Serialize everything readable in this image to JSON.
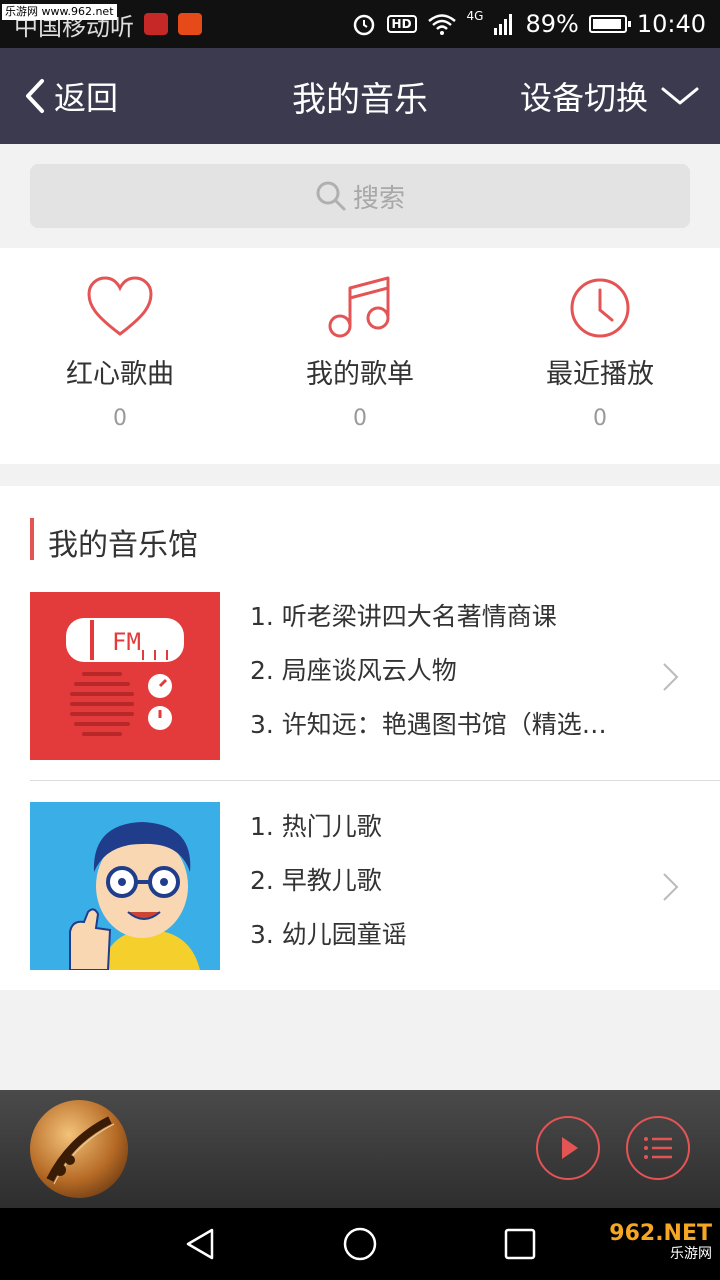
{
  "statusbar": {
    "watermark": "乐游网 www.962.net",
    "carrier": "中国移动听",
    "hd": "HD",
    "network": "4G",
    "battery": "89%",
    "time": "10:40"
  },
  "navbar": {
    "back_label": "返回",
    "title": "我的音乐",
    "device_switch_label": "设备切换"
  },
  "search": {
    "placeholder": "搜索"
  },
  "quick_entries": [
    {
      "label": "红心歌曲",
      "count": "0",
      "icon": "heart-icon"
    },
    {
      "label": "我的歌单",
      "count": "0",
      "icon": "music-note-icon"
    },
    {
      "label": "最近播放",
      "count": "0",
      "icon": "clock-icon"
    }
  ],
  "music_hall": {
    "title": "我的音乐馆",
    "cards": [
      {
        "thumb": "fm-radio",
        "items": [
          "1. 听老梁讲四大名著情商课",
          "2. 局座谈风云人物",
          "3. 许知远：艳遇图书馆（精选…"
        ]
      },
      {
        "thumb": "cartoon-man",
        "items": [
          "1. 热门儿歌",
          "2. 早教儿歌",
          "3. 幼儿园童谣"
        ]
      }
    ]
  },
  "player": {
    "cover": "violin-cover",
    "play_icon": "play-icon",
    "playlist_icon": "playlist-icon"
  },
  "watermark_logo": {
    "main": "962.NET",
    "sub": "乐游网"
  },
  "colors": {
    "accent": "#e45455",
    "navbar": "#3b3a4e",
    "background": "#f2f2f2"
  }
}
